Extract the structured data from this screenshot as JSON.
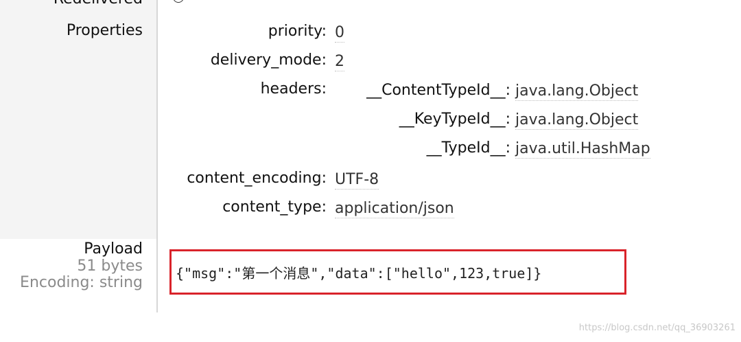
{
  "clipped_top_label": "Redelivered",
  "properties": {
    "section_label": "Properties",
    "priority": {
      "key": "priority:",
      "value": "0"
    },
    "delivery_mode": {
      "key": "delivery_mode:",
      "value": "2"
    },
    "headers": {
      "key": "headers:",
      "items": [
        {
          "key": "__ContentTypeId__:",
          "value": "java.lang.Object"
        },
        {
          "key": "__KeyTypeId__:",
          "value": "java.lang.Object"
        },
        {
          "key": "__TypeId__:",
          "value": "java.util.HashMap"
        }
      ]
    },
    "content_encoding": {
      "key": "content_encoding:",
      "value": "UTF-8"
    },
    "content_type": {
      "key": "content_type:",
      "value": "application/json"
    }
  },
  "payload": {
    "label": "Payload",
    "size": "51 bytes",
    "encoding": "Encoding: string",
    "content": "{\"msg\":\"第一个消息\",\"data\":[\"hello\",123,true]}",
    "highlight_color": "#d9232a"
  },
  "watermark": "https://blog.csdn.net/qq_36903261"
}
